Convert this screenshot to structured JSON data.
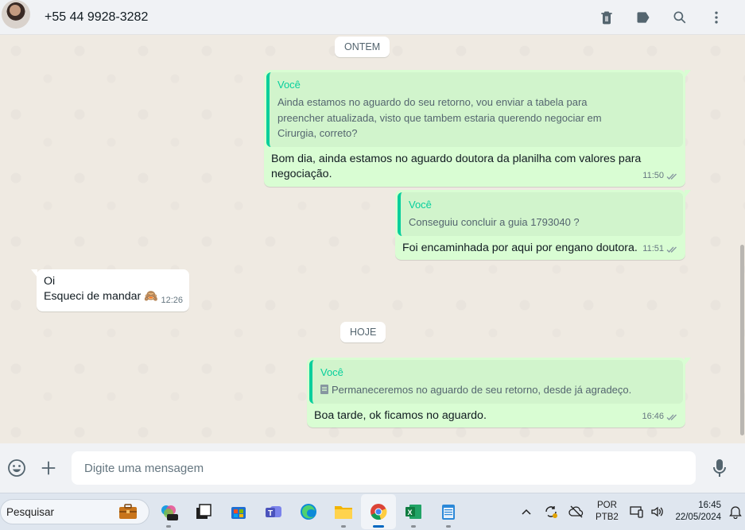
{
  "header": {
    "contact_name": "+55 44 9928-3282"
  },
  "chat": {
    "date_yesterday": "ONTEM",
    "date_today": "HOJE",
    "messages": [
      {
        "quote_author": "Você",
        "quote_lines": [
          "Ainda estamos no aguardo do seu retorno, vou enviar a tabela para",
          "preencher atualizada, visto que tambem estaria querendo negociar em",
          "Cirurgia, correto?"
        ],
        "text_lines": [
          "Bom dia, ainda estamos no aguardo doutora da planilha com valores para",
          "negociação."
        ],
        "time": "11:50"
      },
      {
        "quote_author": "Você",
        "quote_text": "Conseguiu concluir a guia 1793040  ?",
        "text": "Foi encaminhada por aqui por engano doutora.",
        "time": "11:51"
      },
      {
        "text_line1": "Oi",
        "text_line2": "Esqueci de mandar",
        "emoji": "🙈",
        "time": "12:26"
      },
      {
        "quote_author": "Você",
        "quote_text": "Permaneceremos no aguardo de seu retorno, desde já agradeço.",
        "text": "Boa tarde, ok ficamos no aguardo.",
        "time": "16:46"
      }
    ]
  },
  "composer": {
    "placeholder": "Digite uma mensagem"
  },
  "taskbar": {
    "search_text": "Pesquisar",
    "language_line1": "POR",
    "language_line2": "PTB2",
    "time": "16:45",
    "date": "22/05/2024",
    "apps": [
      "copilot-pre",
      "task-view",
      "microsoft-store",
      "teams",
      "edge",
      "file-explorer",
      "chrome",
      "excel",
      "notepad"
    ]
  },
  "colors": {
    "outgoing_bubble": "#d9fdd3",
    "quote_accent": "#06cf9c",
    "chat_background": "#efeae2",
    "header_background": "#f0f2f5"
  }
}
